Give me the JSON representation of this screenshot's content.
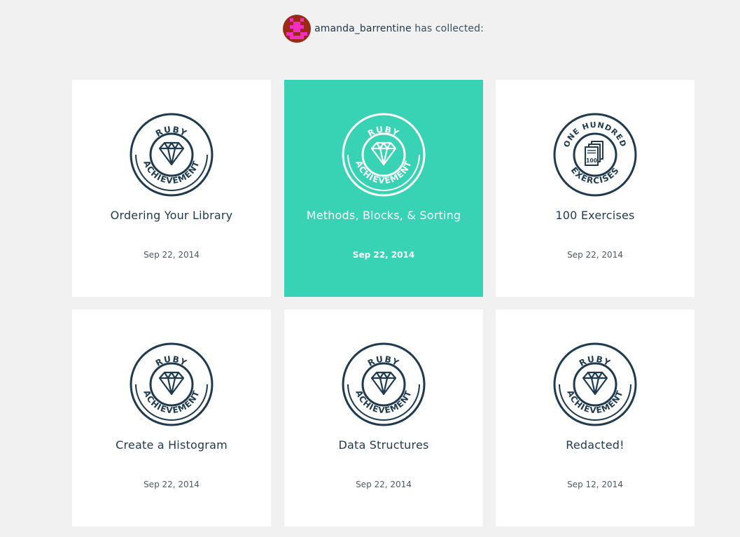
{
  "header": {
    "username": "amanda_barrentine",
    "suffix": "has collected:"
  },
  "colors": {
    "background": "#f0f1f0",
    "card": "#ffffff",
    "active_card": "#37d3b4",
    "badge_ink": "#1e3a4f"
  },
  "cards": [
    {
      "title": "Ordering Your Library",
      "date": "Sep 22, 2014",
      "badge_top": "RUBY",
      "badge_bottom": "ACHIEVEMENT",
      "icon": "diamond-icon"
    },
    {
      "title": "Methods, Blocks, & Sorting",
      "date": "Sep 22, 2014",
      "badge_top": "RUBY",
      "badge_bottom": "ACHIEVEMENT",
      "icon": "diamond-icon"
    },
    {
      "title": "100 Exercises",
      "date": "Sep 22, 2014",
      "badge_top": "ONE HUNDRED",
      "badge_bottom": "EXERCISES",
      "badge_number": "100",
      "icon": "document-stack-icon"
    },
    {
      "title": "Create a Histogram",
      "date": "Sep 22, 2014",
      "badge_top": "RUBY",
      "badge_bottom": "ACHIEVEMENT",
      "icon": "diamond-icon"
    },
    {
      "title": "Data Structures",
      "date": "Sep 22, 2014",
      "badge_top": "RUBY",
      "badge_bottom": "ACHIEVEMENT",
      "icon": "diamond-icon"
    },
    {
      "title": "Redacted!",
      "date": "Sep 12, 2014",
      "badge_top": "RUBY",
      "badge_bottom": "ACHIEVEMENT",
      "icon": "diamond-icon"
    }
  ]
}
